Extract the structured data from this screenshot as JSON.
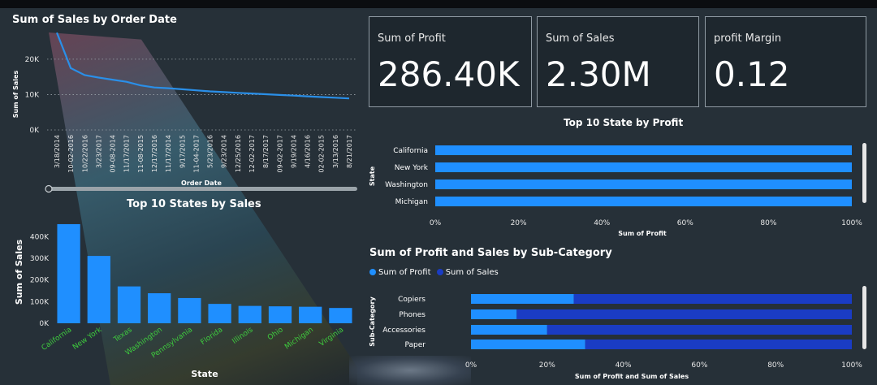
{
  "colors": {
    "bar": "#1f8fff",
    "sales_bar": "#1a3cc4",
    "line": "#2a8fe8",
    "state_label": "#3ecb3e"
  },
  "cards": [
    {
      "label": "Sum of Profit",
      "value": "286.40K"
    },
    {
      "label": "Sum of Sales",
      "value": "2.30M"
    },
    {
      "label": "profit Margin",
      "value": "0.12"
    }
  ],
  "chart_data": [
    {
      "type": "line",
      "title": "Sum of Sales by Order Date",
      "xlabel": "Order Date",
      "ylabel": "Sum of Sales",
      "x": [
        "3/18/2014",
        "10-02-2016",
        "10/22/2016",
        "3/23/2017",
        "09-08-2014",
        "11/17/2017",
        "11-08-2015",
        "12/17/2016",
        "11/17/2014",
        "9/17/2015",
        "11-04-2017",
        "5/23/2016",
        "9/23/2014",
        "12/25/2016",
        "12-02-2017",
        "8/17/2017",
        "09-02-2017",
        "9/19/2014",
        "4/16/2016",
        "02-02-2015",
        "3/13/2016",
        "8/21/2017"
      ],
      "values": [
        27500,
        17500,
        15500,
        14800,
        14200,
        13600,
        12600,
        12000,
        11800,
        11500,
        11200,
        10900,
        10700,
        10500,
        10300,
        10100,
        9900,
        9700,
        9500,
        9300,
        9100,
        8900
      ],
      "yticks": [
        "20K",
        "10K",
        "0K"
      ],
      "ylim": [
        0,
        28000
      ],
      "grid": true
    },
    {
      "type": "bar",
      "title": "Top 10 States by Sales",
      "xlabel": "State",
      "ylabel": "Sum of Sales",
      "categories": [
        "California",
        "New York",
        "Texas",
        "Washington",
        "Pennsylvania",
        "Florida",
        "Illinois",
        "Ohio",
        "Michigan",
        "Virginia"
      ],
      "values": [
        457688,
        310876,
        170188,
        138641,
        116512,
        89474,
        80166,
        78258,
        76270,
        70637
      ],
      "yticks": [
        "400K",
        "300K",
        "200K",
        "100K",
        "0K"
      ],
      "ylim": [
        0,
        480000
      ]
    },
    {
      "type": "bar",
      "orientation": "horizontal",
      "title": "Top 10 State by Profit",
      "xlabel": "Sum of Profit",
      "ylabel": "State",
      "categories": [
        "California",
        "New York",
        "Washington",
        "Michigan"
      ],
      "values": [
        100,
        100,
        100,
        100
      ],
      "xticks": [
        "0%",
        "20%",
        "40%",
        "60%",
        "80%",
        "100%"
      ]
    },
    {
      "type": "bar",
      "orientation": "horizontal",
      "stacked": true,
      "title": "Sum of Profit and Sales by Sub-Category",
      "xlabel": "Sum of Profit and Sum of Sales",
      "ylabel": "Sub-Category",
      "legend": [
        "Sum of Profit",
        "Sum of Sales"
      ],
      "categories": [
        "Copiers",
        "Phones",
        "Accessories",
        "Paper"
      ],
      "series": [
        {
          "name": "Sum of Profit",
          "values": [
            27,
            12,
            20,
            30
          ]
        },
        {
          "name": "Sum of Sales",
          "values": [
            73,
            88,
            80,
            70
          ]
        }
      ],
      "xticks": [
        "0%",
        "20%",
        "40%",
        "60%",
        "80%",
        "100%"
      ]
    }
  ]
}
